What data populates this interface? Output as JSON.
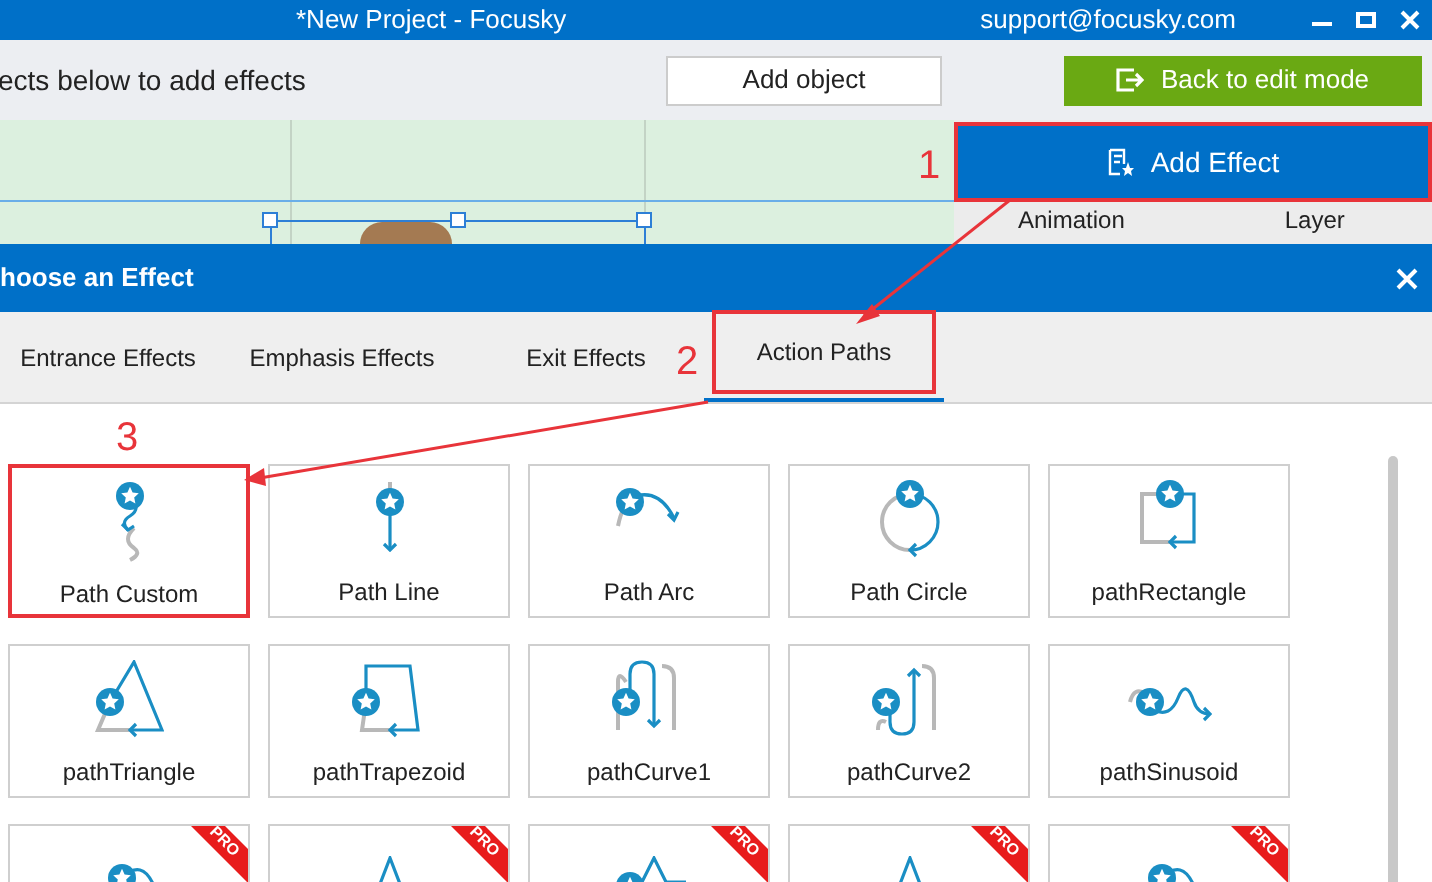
{
  "window": {
    "title": "*New Project - Focusky",
    "support": "support@focusky.com"
  },
  "toolbar": {
    "hint": "ects below to add effects",
    "add_object": "Add object",
    "back_button": "Back to edit mode"
  },
  "side_panel": {
    "add_effect": {
      "label": "Add Effect",
      "highlighted": true,
      "marker": "1"
    },
    "columns": [
      "Animation",
      "Layer"
    ]
  },
  "dialog": {
    "title": "hoose an Effect",
    "tabs": [
      {
        "label": "Entrance Effects",
        "selected": false,
        "highlighted": false
      },
      {
        "label": "Emphasis Effects",
        "selected": false,
        "highlighted": false
      },
      {
        "label": "Exit Effects",
        "selected": false,
        "highlighted": false
      },
      {
        "label": "Action Paths",
        "selected": true,
        "highlighted": true,
        "marker": "2"
      }
    ],
    "effects": [
      {
        "kind": "custom",
        "name": "Path Custom",
        "pro": false,
        "highlighted": true,
        "marker": "3"
      },
      {
        "kind": "line",
        "name": "Path Line",
        "pro": false,
        "highlighted": false
      },
      {
        "kind": "arc",
        "name": "Path Arc",
        "pro": false,
        "highlighted": false
      },
      {
        "kind": "circle",
        "name": "Path Circle",
        "pro": false,
        "highlighted": false
      },
      {
        "kind": "rectangle",
        "name": "pathRectangle",
        "pro": false,
        "highlighted": false
      },
      {
        "kind": "triangle",
        "name": "pathTriangle",
        "pro": false,
        "highlighted": false
      },
      {
        "kind": "trapezoid",
        "name": "pathTrapezoid",
        "pro": false,
        "highlighted": false
      },
      {
        "kind": "curve1",
        "name": "pathCurve1",
        "pro": false,
        "highlighted": false
      },
      {
        "kind": "curve2",
        "name": "pathCurve2",
        "pro": false,
        "highlighted": false
      },
      {
        "kind": "sinusoid",
        "name": "pathSinusoid",
        "pro": false,
        "highlighted": false
      },
      {
        "kind": "loop",
        "pro": true,
        "pro_label": "PRO",
        "highlighted": false
      },
      {
        "kind": "peak",
        "pro": true,
        "pro_label": "PRO",
        "highlighted": false
      },
      {
        "kind": "star",
        "pro": true,
        "pro_label": "PRO",
        "highlighted": false
      },
      {
        "kind": "peak",
        "pro": true,
        "pro_label": "PRO",
        "highlighted": false
      },
      {
        "kind": "loop",
        "pro": true,
        "pro_label": "PRO",
        "highlighted": false
      }
    ]
  }
}
